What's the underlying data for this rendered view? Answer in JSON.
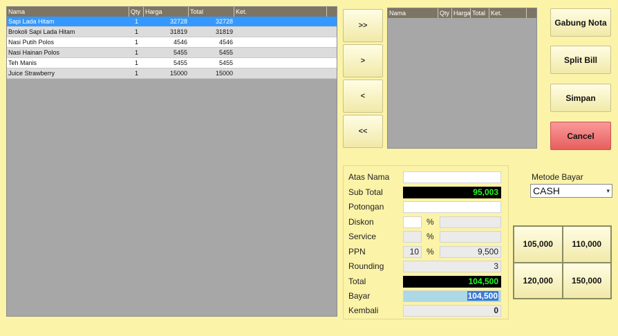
{
  "left_grid": {
    "columns": [
      "Nama",
      "Qty",
      "Harga",
      "Total",
      "Ket."
    ],
    "rows": [
      {
        "nama": "Sapi Lada Hitam",
        "qty": "1",
        "harga": "32728",
        "total": "32728",
        "ket": ""
      },
      {
        "nama": "Brokoli Sapi Lada Hitam",
        "qty": "1",
        "harga": "31819",
        "total": "31819",
        "ket": ""
      },
      {
        "nama": "Nasi Putih Polos",
        "qty": "1",
        "harga": "4546",
        "total": "4546",
        "ket": ""
      },
      {
        "nama": "Nasi Hainan Polos",
        "qty": "1",
        "harga": "5455",
        "total": "5455",
        "ket": ""
      },
      {
        "nama": "Teh Manis",
        "qty": "1",
        "harga": "5455",
        "total": "5455",
        "ket": ""
      },
      {
        "nama": "Juice Strawberry",
        "qty": "1",
        "harga": "15000",
        "total": "15000",
        "ket": ""
      }
    ]
  },
  "right_grid": {
    "columns": [
      "Nama",
      "Qty",
      "Harga",
      "Total",
      "Ket."
    ]
  },
  "transfer": {
    "all_right": ">>",
    "one_right": ">",
    "one_left": "<",
    "all_left": "<<"
  },
  "actions": {
    "gabung": "Gabung Nota",
    "split": "Split Bill",
    "simpan": "Simpan",
    "cancel": "Cancel"
  },
  "payment": {
    "atas_nama_label": "Atas Nama",
    "atas_nama_value": "",
    "sub_total_label": "Sub Total",
    "sub_total_value": "95,003",
    "potongan_label": "Potongan",
    "potongan_value": "",
    "diskon_label": "Diskon",
    "diskon_pct": "",
    "diskon_value": "",
    "service_label": "Service",
    "service_pct": "",
    "service_value": "",
    "ppn_label": "PPN",
    "ppn_pct": "10",
    "ppn_value": "9,500",
    "pct_sign": "%",
    "rounding_label": "Rounding",
    "rounding_value": "3",
    "total_label": "Total",
    "total_value": "104,500",
    "bayar_label": "Bayar",
    "bayar_value": "104,500",
    "kembali_label": "Kembali",
    "kembali_value": "0"
  },
  "metode": {
    "label": "Metode Bayar",
    "selected": "CASH"
  },
  "quick_amounts": [
    "105,000",
    "110,000",
    "120,000",
    "150,000"
  ],
  "colors": {
    "background": "#fbf3a8",
    "grid_header": "#7e7463",
    "selected_row": "#3399ff",
    "cancel": "#e85e5e"
  }
}
